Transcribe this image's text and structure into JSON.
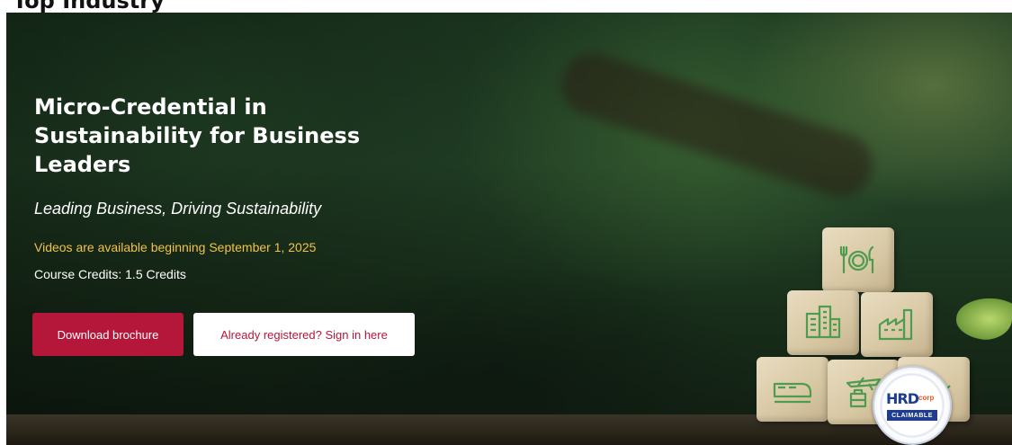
{
  "hero": {
    "title": "Micro-Credential in Sustainability for Business Leaders",
    "subtitle": "Leading Business, Driving Sustainability",
    "availability": "Videos are available beginning September 1, 2025",
    "credits": "Course Credits: 1.5 Credits"
  },
  "buttons": {
    "download_label": "Download brochure",
    "signin_label": "Already registered? Sign in here"
  },
  "badge": {
    "brand": "HRD",
    "brand_suffix": "corp",
    "label": "CLAIMABLE"
  },
  "cube_icons": [
    "dining-icon",
    "city-icon",
    "factory-icon",
    "train-icon",
    "transport-icon",
    "cargo-icon"
  ],
  "colors": {
    "primary_button": "#b5173a",
    "availability_text": "#f0c24b",
    "badge_blue": "#1e3d8f",
    "badge_orange": "#e65a1e"
  }
}
